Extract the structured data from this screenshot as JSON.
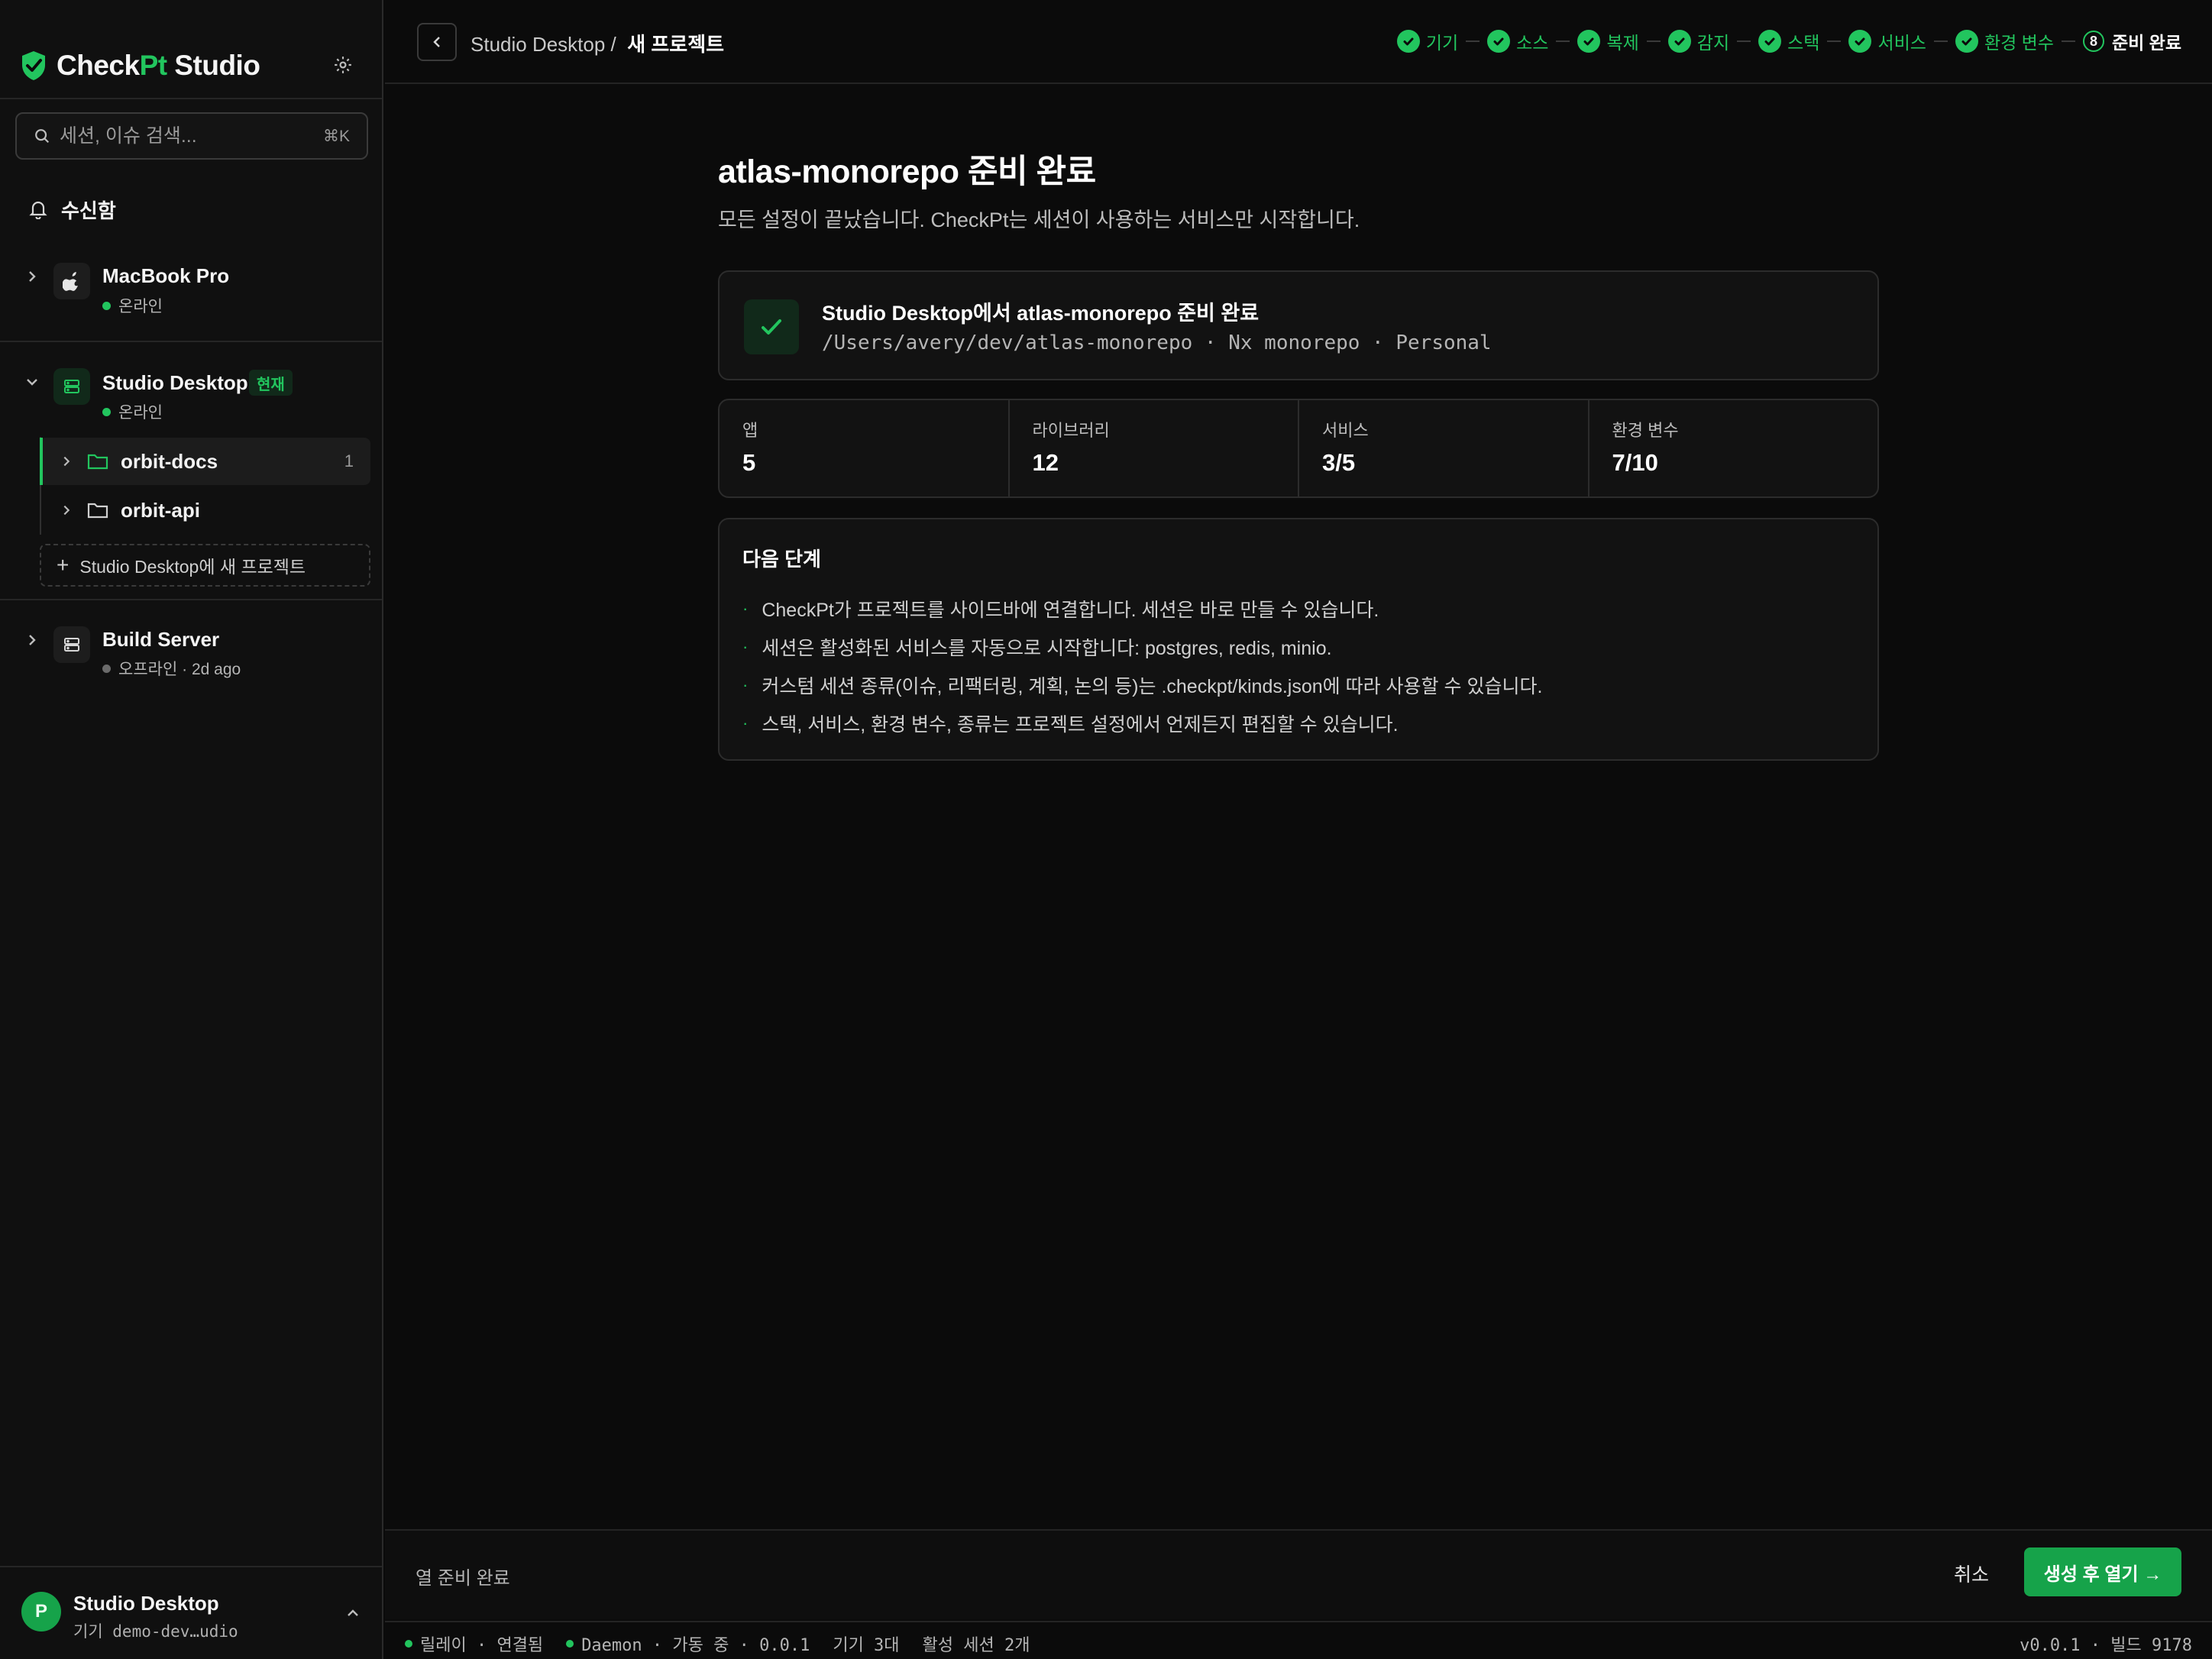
{
  "brand": {
    "name_main": "Check",
    "name_accent": "Pt",
    "name_tail": " Studio"
  },
  "colors": {
    "accent": "#22c55e",
    "accent_dark": "#16a34a",
    "background": "#0b0b0b",
    "sidebar": "#101010"
  },
  "search": {
    "placeholder": "세션, 이슈 검색...",
    "shortcut": "⌘K"
  },
  "sidebar": {
    "inbox_label": "수신함",
    "machines": [
      {
        "name": "MacBook Pro",
        "status": "온라인",
        "icon": "apple-icon"
      },
      {
        "name": "Studio Desktop",
        "status": "온라인",
        "badge": "현재",
        "icon": "server-icon",
        "projects": [
          {
            "name": "orbit-docs",
            "count": "1"
          },
          {
            "name": "orbit-api"
          }
        ],
        "new_project_label": "Studio Desktop에 새 프로젝트"
      },
      {
        "name": "Build Server",
        "status": "오프라인 · 2d ago",
        "icon": "server-icon"
      }
    ]
  },
  "user": {
    "initial": "P",
    "name": "Studio Desktop",
    "subtitle": "기기 demo-dev…udio"
  },
  "topbar": {
    "crumb_parent": "Studio Desktop /",
    "crumb_current": "새 프로젝트",
    "steps": [
      {
        "label": "기기",
        "done": true
      },
      {
        "label": "소스",
        "done": true
      },
      {
        "label": "복제",
        "done": true
      },
      {
        "label": "감지",
        "done": true
      },
      {
        "label": "스택",
        "done": true
      },
      {
        "label": "서비스",
        "done": true
      },
      {
        "label": "환경 변수",
        "done": true
      },
      {
        "label": "준비 완료",
        "number": "8",
        "current": true
      }
    ]
  },
  "main": {
    "title": "atlas-monorepo 준비 완료",
    "subtitle": "모든 설정이 끝났습니다. CheckPt는 세션이 사용하는 서비스만 시작합니다.",
    "ready_card": {
      "title": "Studio Desktop에서 atlas-monorepo 준비 완료",
      "meta": "/Users/avery/dev/atlas-monorepo · Nx monorepo · Personal"
    },
    "stats": [
      {
        "label": "앱",
        "value": "5"
      },
      {
        "label": "라이브러리",
        "value": "12"
      },
      {
        "label": "서비스",
        "value": "3/5"
      },
      {
        "label": "환경 변수",
        "value": "7/10"
      }
    ],
    "next_steps": {
      "title": "다음 단계",
      "items": [
        "CheckPt가 프로젝트를 사이드바에 연결합니다. 세션은 바로 만들 수 있습니다.",
        "세션은 활성화된 서비스를 자동으로 시작합니다: postgres, redis, minio.",
        "커스텀 세션 종류(이슈, 리팩터링, 계획, 논의 등)는 .checkpt/kinds.json에 따라 사용할 수 있습니다.",
        "스택, 서비스, 환경 변수, 종류는 프로젝트 설정에서 언제든지 편집할 수 있습니다."
      ]
    }
  },
  "footer": {
    "status": "열 준비 완료",
    "cancel_label": "취소",
    "primary_label": "생성 후 열기 →"
  },
  "statusbar": {
    "relay": "릴레이 · 연결됨",
    "daemon": "Daemon · 가동 중 · 0.0.1",
    "devices": "기기 3대",
    "sessions": "활성 세션 2개",
    "version": "v0.0.1 · 빌드 9178"
  }
}
